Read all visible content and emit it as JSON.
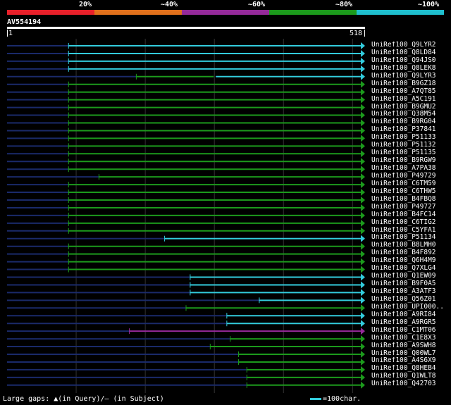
{
  "legend": {
    "labels": [
      "20%",
      "~40%",
      "~60%",
      "~80%",
      "~100%"
    ],
    "colors": [
      "#e8202a",
      "#e0701c",
      "#952a9a",
      "#1c9a1c",
      "#1fbfce"
    ]
  },
  "query": {
    "id": "AV554194",
    "start": "1",
    "end": "518",
    "length": 518
  },
  "hits": [
    {
      "label": "UniRef100_Q9LYR2",
      "color": "cyan",
      "start": 90,
      "end": 518
    },
    {
      "label": "UniRef100_Q8LD84",
      "color": "cyan",
      "start": 90,
      "end": 518
    },
    {
      "label": "UniRef100_Q94JS0",
      "color": "cyan",
      "start": 90,
      "end": 518
    },
    {
      "label": "UniRef100_Q8LEK8",
      "color": "cyan",
      "start": 90,
      "end": 518
    },
    {
      "label": "UniRef100_Q9LYR3",
      "color": "mixed",
      "start": 188,
      "end": 518
    },
    {
      "label": "UniRef100_B9GZ18",
      "color": "green",
      "start": 90,
      "end": 518
    },
    {
      "label": "UniRef100_A7QT85",
      "color": "green",
      "start": 90,
      "end": 518
    },
    {
      "label": "UniRef100_A5C191",
      "color": "green",
      "start": 90,
      "end": 518
    },
    {
      "label": "UniRef100_B9GMU2",
      "color": "green",
      "start": 90,
      "end": 518
    },
    {
      "label": "UniRef100_Q38M54",
      "color": "green",
      "start": 90,
      "end": 518
    },
    {
      "label": "UniRef100_B9RG04",
      "color": "green",
      "start": 90,
      "end": 518
    },
    {
      "label": "UniRef100_P37841",
      "color": "green",
      "start": 90,
      "end": 518
    },
    {
      "label": "UniRef100_P51133",
      "color": "green",
      "start": 90,
      "end": 518
    },
    {
      "label": "UniRef100_P51132",
      "color": "green",
      "start": 90,
      "end": 518
    },
    {
      "label": "UniRef100_P51135",
      "color": "green",
      "start": 90,
      "end": 518
    },
    {
      "label": "UniRef100_B9RGW9",
      "color": "green",
      "start": 90,
      "end": 518
    },
    {
      "label": "UniRef100_A7PA38",
      "color": "green",
      "start": 90,
      "end": 518
    },
    {
      "label": "UniRef100_P49729",
      "color": "green",
      "start": 134,
      "end": 518
    },
    {
      "label": "UniRef100_C6TM59",
      "color": "green",
      "start": 90,
      "end": 518
    },
    {
      "label": "UniRef100_C6THW5",
      "color": "green",
      "start": 90,
      "end": 518
    },
    {
      "label": "UniRef100_B4FBQ8",
      "color": "green",
      "start": 90,
      "end": 518
    },
    {
      "label": "UniRef100_P49727",
      "color": "green",
      "start": 90,
      "end": 518
    },
    {
      "label": "UniRef100_B4FC14",
      "color": "green",
      "start": 90,
      "end": 518
    },
    {
      "label": "UniRef100_C6TIG2",
      "color": "green",
      "start": 90,
      "end": 518
    },
    {
      "label": "UniRef100_C5YFA1",
      "color": "green",
      "start": 90,
      "end": 518
    },
    {
      "label": "UniRef100_P51134",
      "color": "cyan",
      "start": 229,
      "end": 518
    },
    {
      "label": "UniRef100_B8LMH0",
      "color": "green",
      "start": 90,
      "end": 518
    },
    {
      "label": "UniRef100_B4F892",
      "color": "green",
      "start": 90,
      "end": 518
    },
    {
      "label": "UniRef100_Q6H4M9",
      "color": "green",
      "start": 90,
      "end": 518
    },
    {
      "label": "UniRef100_Q7XLG4",
      "color": "green",
      "start": 90,
      "end": 518
    },
    {
      "label": "UniRef100_Q1EW09",
      "color": "cyan",
      "start": 266,
      "end": 518
    },
    {
      "label": "UniRef100_B9F0A5",
      "color": "cyan",
      "start": 266,
      "end": 518
    },
    {
      "label": "UniRef100_A3ATF3",
      "color": "cyan",
      "start": 266,
      "end": 518
    },
    {
      "label": "UniRef100_Q56Z01",
      "color": "cyan",
      "start": 366,
      "end": 518
    },
    {
      "label": "UniRef100_UPI000..",
      "color": "green",
      "start": 260,
      "end": 518
    },
    {
      "label": "UniRef100_A9RI84",
      "color": "cyan",
      "start": 319,
      "end": 518
    },
    {
      "label": "UniRef100_A9RGR5",
      "color": "cyan",
      "start": 319,
      "end": 518
    },
    {
      "label": "UniRef100_C1MT06",
      "color": "purple",
      "start": 178,
      "end": 518
    },
    {
      "label": "UniRef100_C1E8X3",
      "color": "green",
      "start": 324,
      "end": 518
    },
    {
      "label": "UniRef100_A9SWH8",
      "color": "green",
      "start": 295,
      "end": 518
    },
    {
      "label": "UniRef100_Q00WL7",
      "color": "green",
      "start": 336,
      "end": 518
    },
    {
      "label": "UniRef100_A4S6X9",
      "color": "green",
      "start": 336,
      "end": 518
    },
    {
      "label": "UniRef100_Q8HEB4",
      "color": "green",
      "start": 348,
      "end": 518
    },
    {
      "label": "UniRef100_Q1WLT8",
      "color": "green",
      "start": 348,
      "end": 518
    },
    {
      "label": "UniRef100_Q42703",
      "color": "green",
      "start": 348,
      "end": 518
    }
  ],
  "footer": {
    "gaps_text": "Large gaps: ▲(in Query)/– (in Subject)",
    "scale_text": "=100char."
  }
}
